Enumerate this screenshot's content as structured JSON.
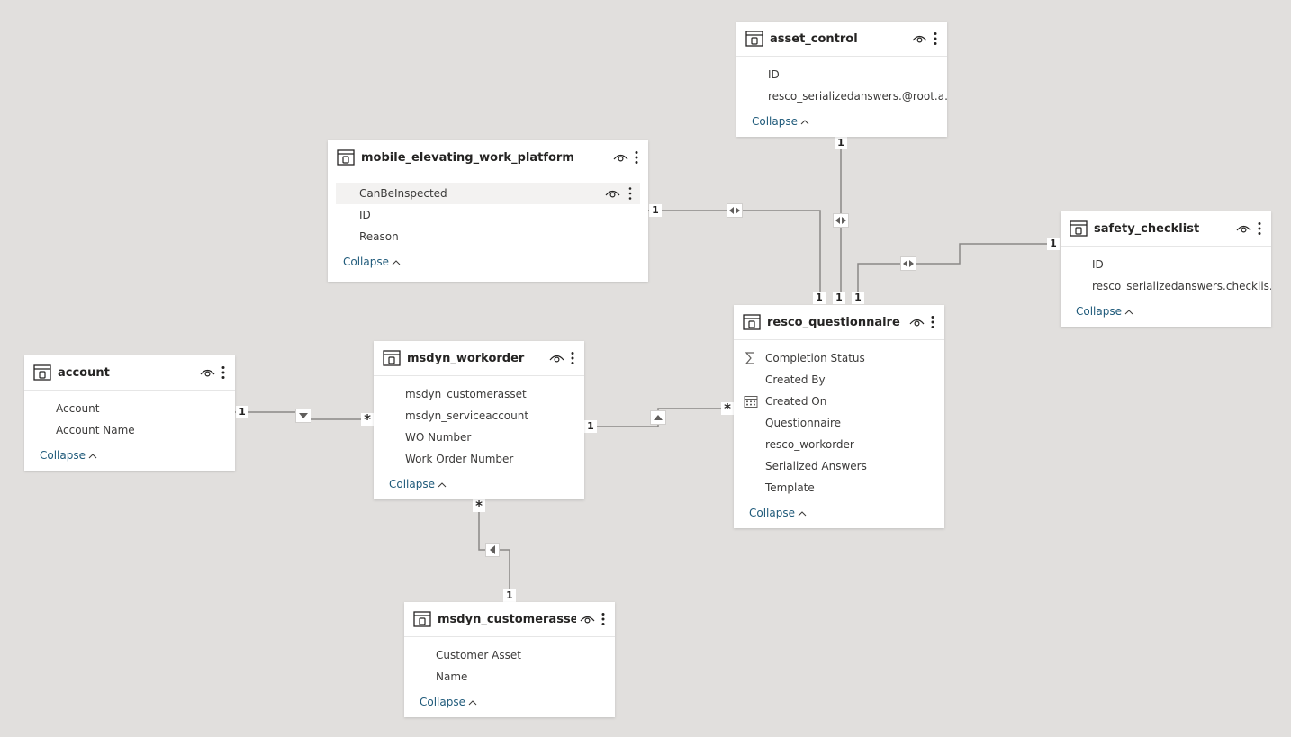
{
  "tables": {
    "asset_control": {
      "title": "asset_control",
      "fields": [
        "ID",
        "resco_serializedanswers.@root.a..."
      ],
      "collapse": "Collapse"
    },
    "mobile_elevating_work_platform": {
      "title": "mobile_elevating_work_platform",
      "fields": [
        "CanBeInspected",
        "ID",
        "Reason"
      ],
      "collapse": "Collapse"
    },
    "safety_checklist": {
      "title": "safety_checklist",
      "fields": [
        "ID",
        "resco_serializedanswers.checklis..."
      ],
      "collapse": "Collapse"
    },
    "resco_questionnaire": {
      "title": "resco_questionnaire",
      "fields": [
        "Completion Status",
        "Created By",
        "Created On",
        "Questionnaire",
        "resco_workorder",
        "Serialized Answers",
        "Template"
      ],
      "collapse": "Collapse"
    },
    "account": {
      "title": "account",
      "fields": [
        "Account",
        "Account Name"
      ],
      "collapse": "Collapse"
    },
    "msdyn_workorder": {
      "title": "msdyn_workorder",
      "fields": [
        "msdyn_customerasset",
        "msdyn_serviceaccount",
        "WO Number",
        "Work Order Number"
      ],
      "collapse": "Collapse"
    },
    "msdyn_customerasset": {
      "title": "msdyn_customerasset",
      "fields": [
        "Customer Asset",
        "Name"
      ],
      "collapse": "Collapse"
    }
  },
  "relationships": {
    "asset_to_questionnaire": {
      "from": "1",
      "to": "1",
      "direction": "both"
    },
    "mewp_to_questionnaire": {
      "from": "1",
      "to": "1",
      "direction": "both"
    },
    "safety_to_questionnaire": {
      "from": "1",
      "to": "1",
      "direction": "both"
    },
    "account_to_workorder": {
      "from": "1",
      "to": "*",
      "direction": "single"
    },
    "workorder_to_questionnaire": {
      "from": "1",
      "to": "*",
      "direction": "single"
    },
    "customerasset_to_workorder": {
      "from": "1",
      "to": "*",
      "direction": "single"
    }
  },
  "colors": {
    "canvas": "#e1dfdd",
    "card": "#ffffff",
    "line": "#8a8886",
    "collapse_link": "#1f5a7a"
  }
}
